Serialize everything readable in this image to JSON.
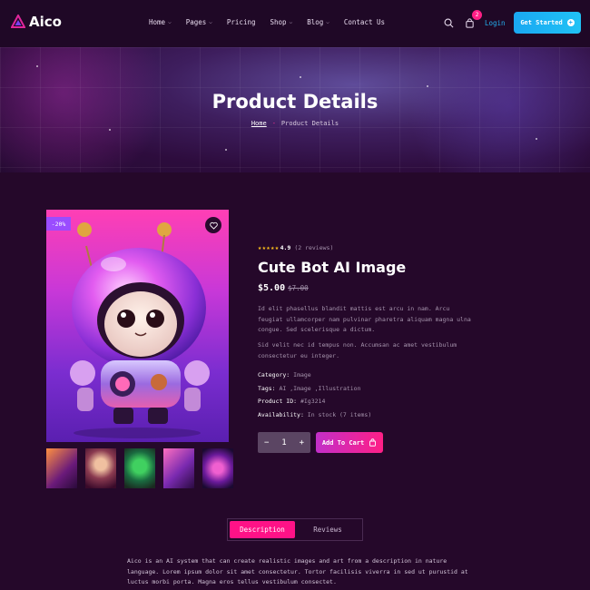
{
  "brand": {
    "name": "Aico"
  },
  "nav": {
    "items": [
      {
        "label": "Home",
        "dropdown": true
      },
      {
        "label": "Pages",
        "dropdown": true
      },
      {
        "label": "Pricing",
        "dropdown": false
      },
      {
        "label": "Shop",
        "dropdown": true
      },
      {
        "label": "Blog",
        "dropdown": true
      },
      {
        "label": "Contact Us",
        "dropdown": false
      }
    ],
    "cart_count": "2",
    "login": "Login",
    "cta": "Get Started"
  },
  "hero": {
    "title": "Product Details",
    "breadcrumb_home": "Home",
    "breadcrumb_sep": "-",
    "breadcrumb_current": "Product Details"
  },
  "product": {
    "discount_badge": "-20%",
    "rating_stars": "★★★★★",
    "rating_value": "4.9",
    "reviews": "(2 reviews)",
    "title": "Cute Bot AI Image",
    "price_now": "$5.00",
    "price_old": "$7.00",
    "desc1": "Id elit phasellus blandit mattis est arcu in nam. Arcu feugiat ullamcorper nam pulvinar pharetra aliquam magna ulna congue. Sed scelerisque a dictum.",
    "desc2": "Sid velit nec id tempus non. Accumsan ac amet vestibulum consectetur eu integer.",
    "category_label": "Category:",
    "category_value": "Image",
    "tags_label": "Tags:",
    "tags_value": "AI ,Image ,Illustration",
    "id_label": "Product ID:",
    "id_value": "#Ig3214",
    "avail_label": "Availability:",
    "avail_value": "In stock (7 items)",
    "qty_minus": "−",
    "qty_value": "1",
    "qty_plus": "+",
    "add_to_cart": "Add To Cart"
  },
  "tabs": {
    "description": "Description",
    "reviews": "Reviews"
  },
  "description_text": "Aico is an AI system that can create realistic images and art from a description in nature language. Lorem ipsum dolor sit amet consectetur. Tortor facilisis viverra in sed ut purustid at luctus morbi porta. Magna eros tellus vestibulum consectet.",
  "colors": {
    "accent": "#ff1287",
    "cta": "#1aa8f2",
    "background": "#25082a"
  }
}
